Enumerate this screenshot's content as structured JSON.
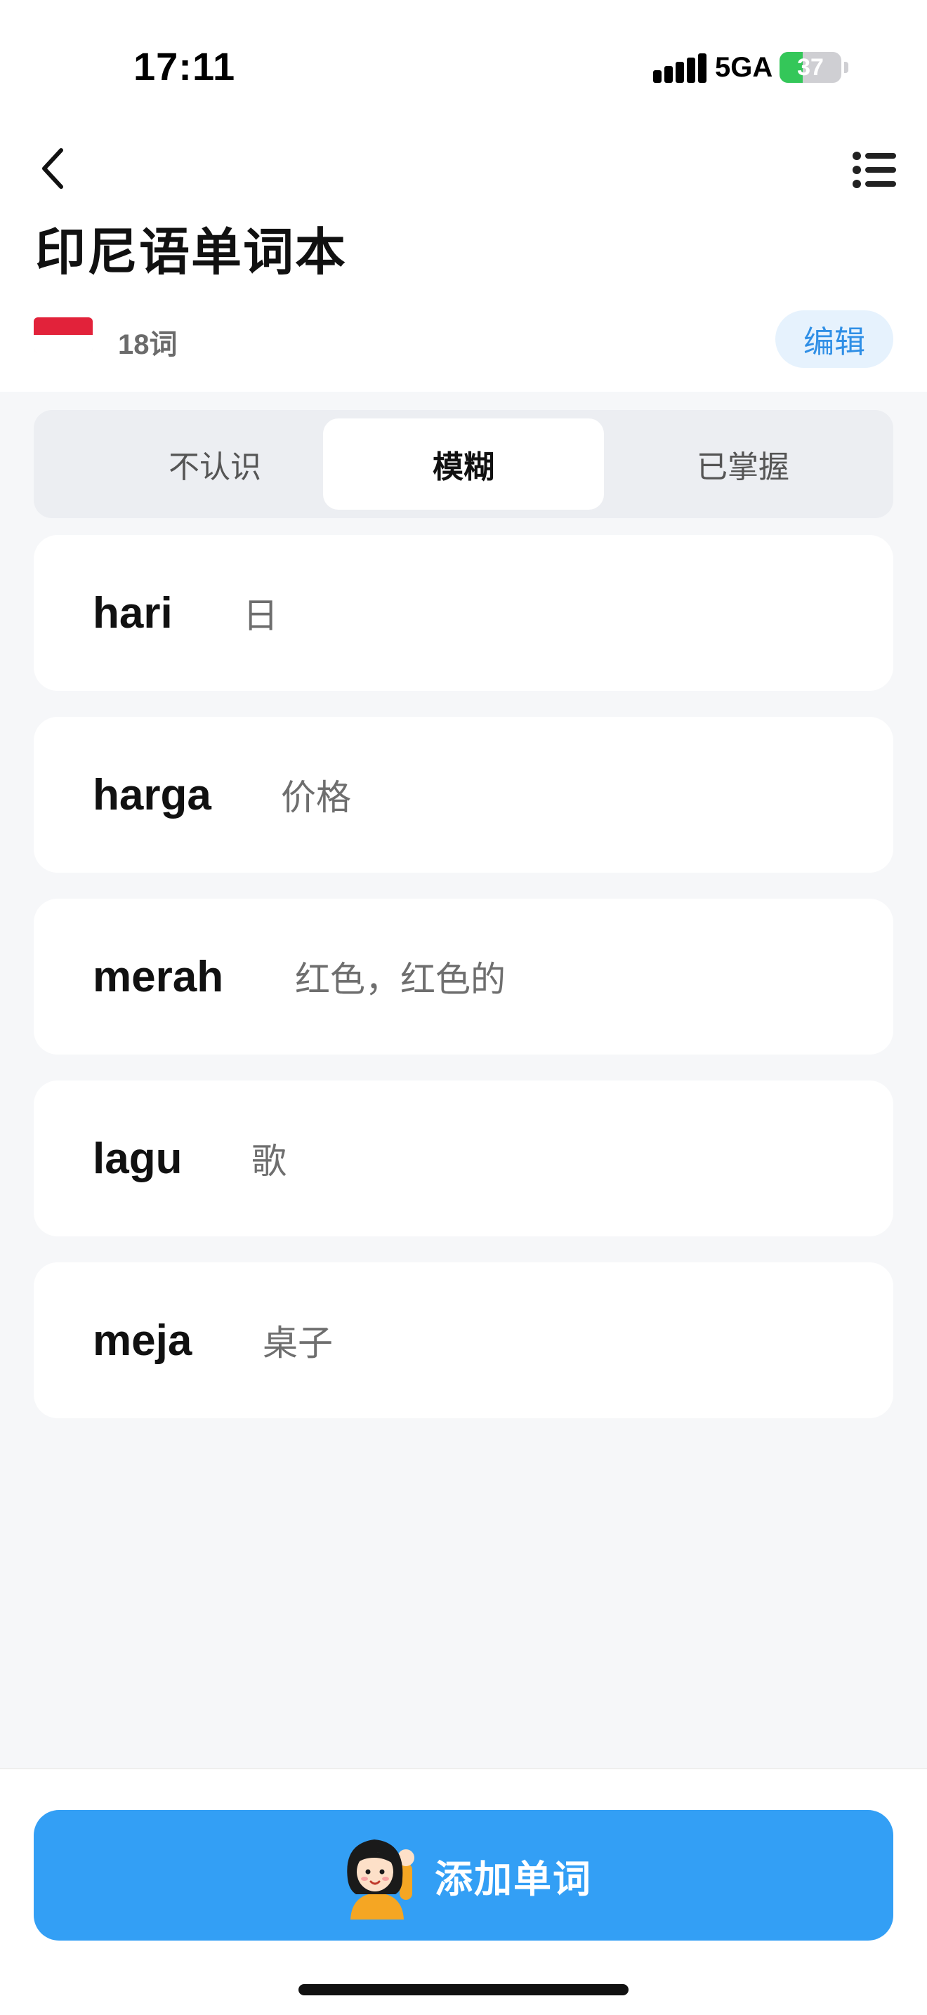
{
  "status_bar": {
    "time": "17:11",
    "network": "5GA",
    "battery_percent": 37,
    "battery_label": "37"
  },
  "header": {
    "title": "印尼语单词本",
    "word_count": "18词",
    "edit_label": "编辑"
  },
  "tabs": [
    {
      "label": "不认识",
      "active": false
    },
    {
      "label": "模糊",
      "active": true
    },
    {
      "label": "已掌握",
      "active": false
    }
  ],
  "words": [
    {
      "word": "hari",
      "meaning": "日"
    },
    {
      "word": "harga",
      "meaning": "价格"
    },
    {
      "word": "merah",
      "meaning": "红色，红色的"
    },
    {
      "word": "lagu",
      "meaning": "歌"
    },
    {
      "word": "meja",
      "meaning": "桌子"
    }
  ],
  "add_button": {
    "label": "添加单词"
  },
  "colors": {
    "accent": "#339ff5",
    "edit_text": "#2f8fe6",
    "battery_green": "#34c759",
    "flag_red": "#e2223a"
  },
  "icons": [
    "back-arrow-icon",
    "list-menu-icon",
    "signal-icon",
    "battery-icon",
    "indonesia-flag-icon",
    "mascot-icon"
  ]
}
